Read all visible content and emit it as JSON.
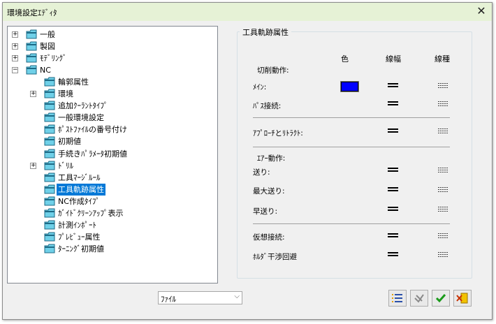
{
  "window": {
    "title": "環境設定ｴﾃﾞｨﾀ",
    "close_glyph": "✕"
  },
  "tree": {
    "items": [
      {
        "label": "一般",
        "expander": "+",
        "level": 0
      },
      {
        "label": "製図",
        "expander": "+",
        "level": 0
      },
      {
        "label": "ﾓﾃﾞﾘﾝｸﾞ",
        "expander": "+",
        "level": 0
      },
      {
        "label": "NC",
        "expander": "−",
        "level": 0
      },
      {
        "label": "輪郭属性",
        "expander": "",
        "level": 1
      },
      {
        "label": "環境",
        "expander": "+",
        "level": 1
      },
      {
        "label": "追加ｸｰﾗﾝﾄﾀｲﾌﾟ",
        "expander": "",
        "level": 1
      },
      {
        "label": "一般環境設定",
        "expander": "",
        "level": 1
      },
      {
        "label": "ﾎﾟｽﾄﾌｧｲﾙの番号付け",
        "expander": "",
        "level": 1
      },
      {
        "label": "初期値",
        "expander": "",
        "level": 1
      },
      {
        "label": "手続きﾊﾟﾗﾒｰﾀ初期値",
        "expander": "",
        "level": 1
      },
      {
        "label": "ﾄﾞﾘﾙ",
        "expander": "+",
        "level": 1
      },
      {
        "label": "工具ﾏｰｼﾞﾙｰﾙ",
        "expander": "",
        "level": 1
      },
      {
        "label": "工具軌跡属性",
        "expander": "",
        "level": 1,
        "selected": true
      },
      {
        "label": "NC作成ﾀｲﾌﾟ",
        "expander": "",
        "level": 1
      },
      {
        "label": "ｶﾞｲﾄﾞｸﾘｰﾝｱｯﾌﾟ表示",
        "expander": "",
        "level": 1
      },
      {
        "label": "計測ｲﾝﾎﾟｰﾄ",
        "expander": "",
        "level": 1
      },
      {
        "label": "ﾌﾟﾚﾋﾞｭｰ属性",
        "expander": "",
        "level": 1
      },
      {
        "label": "ﾀｰﾆﾝｸﾞ初期値",
        "expander": "",
        "level": 1
      }
    ]
  },
  "properties": {
    "group_title": "工具軌跡属性",
    "columns": {
      "color": "色",
      "width": "線幅",
      "type": "線種"
    },
    "section_cutting": "切削動作:",
    "row_main": "ﾒｲﾝ:",
    "row_pass_link": "ﾊﾟｽ接続:",
    "row_approach": "ｱﾌﾟﾛｰﾁとﾘﾄﾗｸﾄ:",
    "section_air": "ｴｱｰ動作:",
    "row_feed": "送り:",
    "row_max_feed": "最大送り:",
    "row_rapid": "早送り:",
    "row_virtual_link": "仮想接続:",
    "row_holder_avoid": "ﾎﾙﾀﾞ干渉回避",
    "main_color": "#0000ff"
  },
  "footer": {
    "dropdown_value": "ﾌｧｲﾙ",
    "buttons": [
      "list-settings-icon",
      "revert-icon",
      "checkmark-icon",
      "exit-icon"
    ]
  }
}
